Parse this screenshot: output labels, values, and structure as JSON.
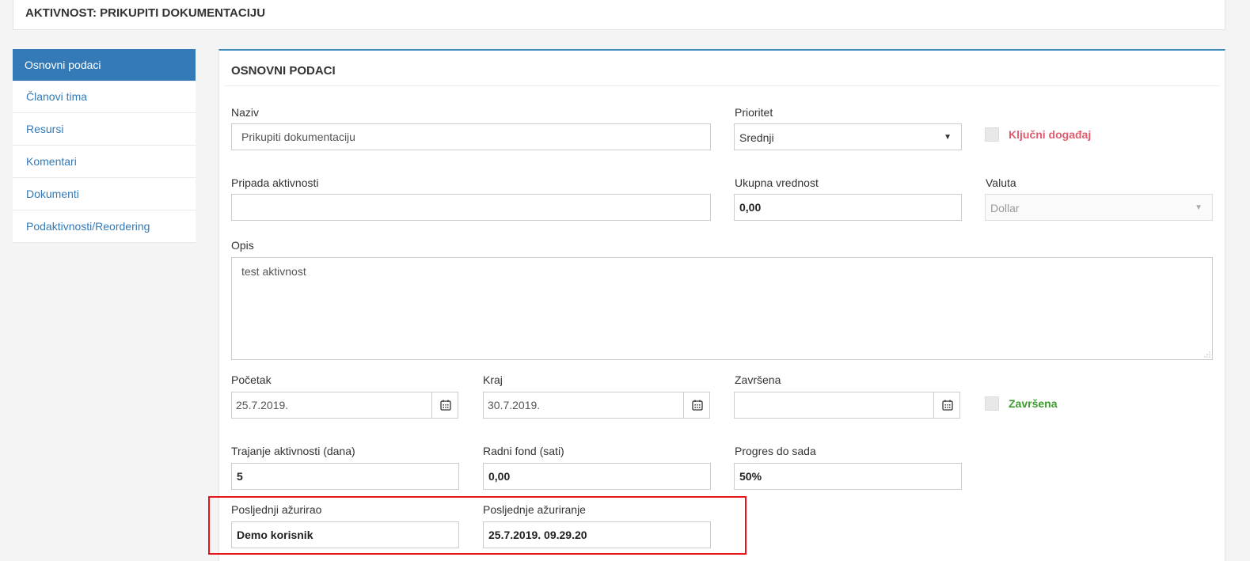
{
  "header": {
    "title": "AKTIVNOST: PRIKUPITI DOKUMENTACIJU"
  },
  "sidebar": {
    "items": [
      {
        "label": "Osnovni podaci",
        "active": true
      },
      {
        "label": "Članovi tima"
      },
      {
        "label": "Resursi"
      },
      {
        "label": "Komentari"
      },
      {
        "label": "Dokumenti"
      },
      {
        "label": "Podaktivnosti/Reordering"
      }
    ]
  },
  "panel": {
    "title": "OSNOVNI PODACI"
  },
  "form": {
    "naziv": {
      "label": "Naziv",
      "value": "Prikupiti dokumentaciju"
    },
    "prioritet": {
      "label": "Prioritet",
      "value": "Srednji"
    },
    "kljucni": {
      "label": "Ključni događaj",
      "checked": false
    },
    "pripada": {
      "label": "Pripada aktivnosti",
      "value": ""
    },
    "ukupna": {
      "label": "Ukupna vrednost",
      "value": "0,00"
    },
    "valuta": {
      "label": "Valuta",
      "value": "Dollar"
    },
    "opis": {
      "label": "Opis",
      "value": "test aktivnost"
    },
    "pocetak": {
      "label": "Početak",
      "value": "25.7.2019."
    },
    "kraj": {
      "label": "Kraj",
      "value": "30.7.2019."
    },
    "zavrsena_date": {
      "label": "Završena",
      "value": ""
    },
    "zavrsena_chk": {
      "label": "Završena",
      "checked": false
    },
    "trajanje": {
      "label": "Trajanje aktivnosti (dana)",
      "value": "5"
    },
    "radni_fond": {
      "label": "Radni fond (sati)",
      "value": "0,00"
    },
    "progres": {
      "label": "Progres do sada",
      "value": "50%"
    },
    "posljednji": {
      "label": "Posljednji ažurirao",
      "value": "Demo korisnik"
    },
    "posljednje": {
      "label": "Posljednje ažuriranje",
      "value": "25.7.2019. 09.29.20"
    }
  },
  "colors": {
    "accent": "#337ab7",
    "danger_label": "#e05d6f",
    "success_label": "#3a9d2a",
    "highlight": "#e8141c"
  },
  "icons": {
    "date_picker": "calendar-icon",
    "dropdown": "caret-down-icon"
  }
}
